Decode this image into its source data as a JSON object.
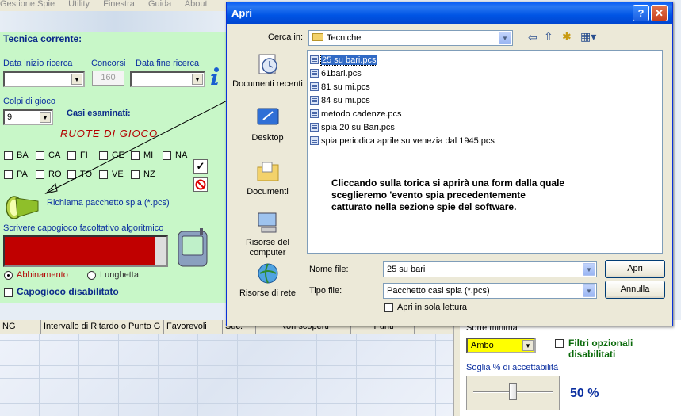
{
  "app": {
    "menu": [
      "Gestione Spie",
      "Utility",
      "Finestra",
      "Guida",
      "About"
    ],
    "tecnica_label": "Tecnica corrente:",
    "data_inizio_label": "Data inizio ricerca",
    "concorsi_label": "Concorsi",
    "concorsi_value": "160",
    "data_fine_label": "Data fine ricerca",
    "colpi_label": "Colpi di gioco",
    "colpi_value": "9",
    "casi_label": "Casi esaminati:",
    "ruote_title": "RUOTE  DI  GIOCO",
    "ruote_row1": [
      "BA",
      "CA",
      "FI",
      "GE",
      "MI",
      "NA"
    ],
    "ruote_row2": [
      "PA",
      "RO",
      "TO",
      "VE",
      "NZ"
    ],
    "richiama_label": "Richiama pacchetto spia (*.pcs)",
    "capogioco_label": "Scrivere capogioco facoltativo algoritmico",
    "abbinamento_label": "Abbinamento",
    "lunghetta_label": "Lunghetta",
    "capogioco_disabilitato_label": "Capogioco disabilitato",
    "grid_headers": [
      "NG",
      "Intervallo di Ritardo o Punto G",
      "Favorevoli",
      "Suc.",
      "Non scoperti",
      "Punti"
    ],
    "sorte_label": "Sorte minima",
    "sorte_value": "Ambo",
    "filtri_label": "Filtri opzionali disabilitati",
    "soglia_label": "Soglia % di accettabilità",
    "soglia_value": "50 %",
    "soglia_fraction": 0.5
  },
  "dialog": {
    "title": "Apri",
    "help_glyph": "?",
    "close_glyph": "✕",
    "cerca_label": "Cerca in:",
    "cerca_value": "Tecniche",
    "places": [
      "Documenti recenti",
      "Desktop",
      "Documenti",
      "Risorse del computer",
      "Risorse di rete"
    ],
    "files": [
      "25 su bari.pcs",
      "61bari.pcs",
      "81 su mi.pcs",
      "84 su mi.pcs",
      "metodo cadenze.pcs",
      "spia 20 su Bari.pcs",
      "spia periodica aprile su venezia dal 1945.pcs"
    ],
    "note_lines": [
      "Cliccando sulla torica si aprirà una form dalla quale",
      "sceglieremo 'evento spia precedentemente",
      "catturato nella sezione spie del software."
    ],
    "nome_file_label": "Nome file:",
    "nome_file_value": "25 su bari",
    "tipo_file_label": "Tipo file:",
    "tipo_file_value": "Pacchetto casi spia (*.pcs)",
    "readonly_label": "Apri in sola lettura",
    "open_button": "Apri",
    "cancel_button": "Annulla"
  },
  "colors": {
    "panel_green": "#c8f7c8",
    "title_blue": "#0055e5",
    "selection": "#316ac5",
    "ruote_red": "#b30000"
  }
}
